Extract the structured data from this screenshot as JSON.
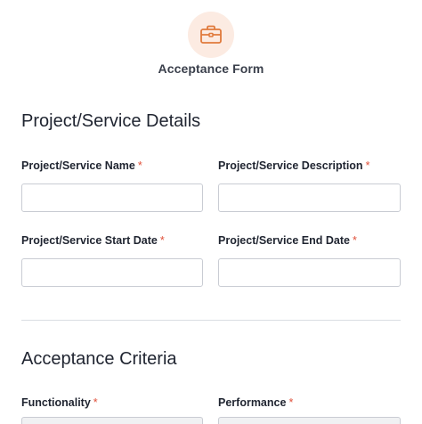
{
  "header": {
    "icon": "briefcase-icon",
    "title": "Acceptance Form",
    "accent_color": "#e07a3c"
  },
  "sections": {
    "details": {
      "title": "Project/Service Details",
      "fields": {
        "name_label": "Project/Service Name",
        "description_label": "Project/Service Description",
        "start_label": "Project/Service Start Date",
        "end_label": "Project/Service End Date"
      }
    },
    "criteria": {
      "title": "Acceptance Criteria",
      "fields": {
        "functionality_label": "Functionality",
        "performance_label": "Performance"
      }
    }
  },
  "required_marker": "*",
  "colors": {
    "required": "#e0503a",
    "icon_bg": "#fcebe2"
  }
}
